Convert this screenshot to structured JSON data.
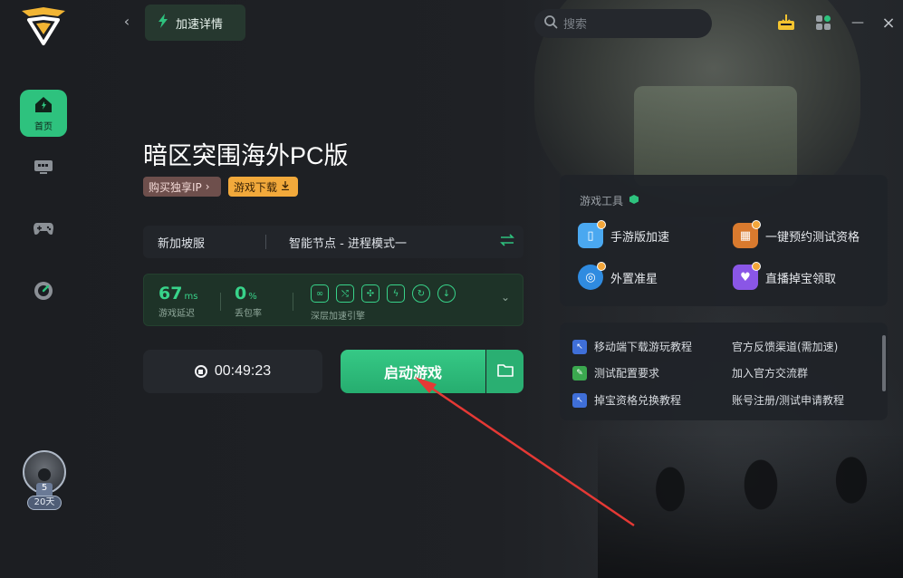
{
  "header": {
    "back_label": "‹",
    "active_tab": "加速详情",
    "search_placeholder": "搜索",
    "minimize": "—",
    "close": "×"
  },
  "sidebar": {
    "items": [
      {
        "label": "首页",
        "icon": "home-icon",
        "active": true
      },
      {
        "label": "",
        "icon": "monitor-icon",
        "active": false
      },
      {
        "label": "",
        "icon": "gamepad-icon",
        "active": false
      },
      {
        "label": "",
        "icon": "speedometer-icon",
        "active": false
      }
    ],
    "user": {
      "level": "5",
      "days": "20天"
    }
  },
  "game": {
    "title": "暗区突围海外PC版",
    "buy_ip": "购买独享IP",
    "download": "游戏下载"
  },
  "server": {
    "region": "新加坡服",
    "node": "智能节点 - 进程模式一"
  },
  "stats": {
    "latency": "67",
    "latency_unit": "ms",
    "latency_label": "游戏延迟",
    "loss": "0",
    "loss_unit": "%",
    "loss_label": "丢包率",
    "engine_label": "深层加速引擎"
  },
  "controls": {
    "timer": "00:49:23",
    "launch": "启动游戏"
  },
  "tools": {
    "title": "游戏工具",
    "items": [
      {
        "label": "手游版加速",
        "icon": "phone-icon",
        "color": "#4aa8f0"
      },
      {
        "label": "一键预约测试资格",
        "icon": "calendar-icon",
        "color": "#d97a2e"
      },
      {
        "label": "外置准星",
        "icon": "crosshair-icon",
        "color": "#2f8be0"
      },
      {
        "label": "直播掉宝领取",
        "icon": "gift-icon",
        "color": "#8a56e6"
      }
    ]
  },
  "links": {
    "items": [
      {
        "label": "移动端下载游玩教程",
        "icon": "tutorial-icon"
      },
      {
        "label": "官方反馈渠道(需加速)",
        "icon": ""
      },
      {
        "label": "测试配置要求",
        "icon": "check-icon"
      },
      {
        "label": "加入官方交流群",
        "icon": ""
      },
      {
        "label": "掉宝资格兑换教程",
        "icon": "tutorial-icon"
      },
      {
        "label": "账号注册/测试申请教程",
        "icon": ""
      }
    ]
  },
  "colors": {
    "accent": "#2ec27e",
    "download_pill": "#f2a93b",
    "ip_pill": "#6e4f4c",
    "annotation_arrow": "#e53935"
  }
}
